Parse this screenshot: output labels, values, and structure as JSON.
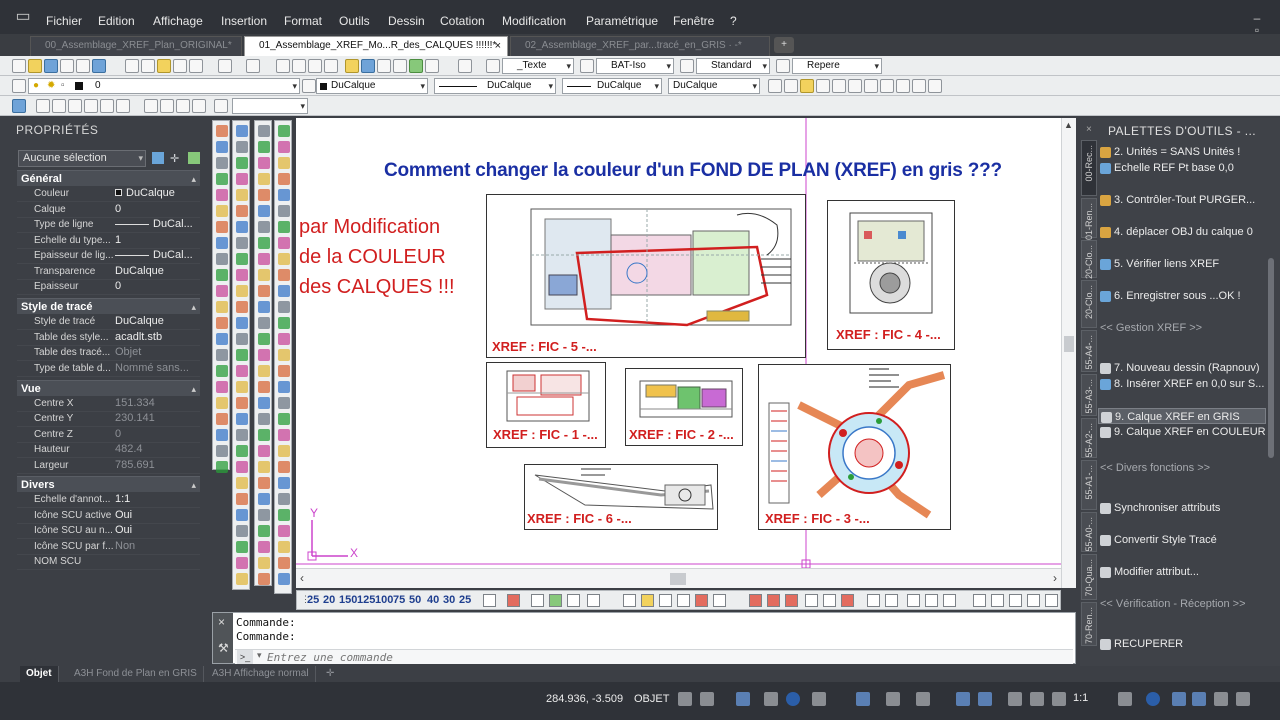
{
  "menu": [
    "Fichier",
    "Edition",
    "Affichage",
    "Insertion",
    "Format",
    "Outils",
    "Dessin",
    "Cotation",
    "Modification",
    "Paramétrique",
    "Fenêtre",
    "?"
  ],
  "doc_tabs": [
    {
      "label": "00_Assemblage_XREF_Plan_ORIGINAL*",
      "active": false
    },
    {
      "label": "01_Assemblage_XREF_Mo...R_des_CALQUES !!!!!!*",
      "active": true
    },
    {
      "label": "02_Assemblage_XREF_par...tracé_en_GRIS  · -*",
      "active": false
    }
  ],
  "toolbar": {
    "text_style": "_Texte",
    "dim_style": "BAT-Iso",
    "table_style": "Standard",
    "mleader_style": "Repere",
    "layer": "0",
    "color": "DuCalque",
    "linetype": "DuCalque",
    "lineweight": "DuCalque",
    "plotstyle": "DuCalque"
  },
  "properties": {
    "title": "PROPRIÉTÉS",
    "selection": "Aucune sélection",
    "sections": [
      {
        "title": "Général",
        "rows": [
          {
            "k": "Couleur",
            "v": "DuCalque"
          },
          {
            "k": "Calque",
            "v": "0"
          },
          {
            "k": "Type de ligne",
            "v": "DuCal..."
          },
          {
            "k": "Echelle du type...",
            "v": "1"
          },
          {
            "k": "Epaisseur de lig...",
            "v": "DuCal..."
          },
          {
            "k": "Transparence",
            "v": "DuCalque"
          },
          {
            "k": "Epaisseur",
            "v": "0"
          }
        ]
      },
      {
        "title": "Style de tracé",
        "rows": [
          {
            "k": "Style de tracé",
            "v": "DuCalque"
          },
          {
            "k": "Table des style...",
            "v": "acadlt.stb"
          },
          {
            "k": "Table des tracé...",
            "v": "Objet"
          },
          {
            "k": "Type de table d...",
            "v": "Nommé  sans..."
          }
        ]
      },
      {
        "title": "Vue",
        "rows": [
          {
            "k": "Centre X",
            "v": "151.334"
          },
          {
            "k": "Centre Y",
            "v": "230.141"
          },
          {
            "k": "Centre Z",
            "v": "0"
          },
          {
            "k": "Hauteur",
            "v": "482.4"
          },
          {
            "k": "Largeur",
            "v": "785.691"
          }
        ]
      },
      {
        "title": "Divers",
        "rows": [
          {
            "k": "Echelle d'annot...",
            "v": "1:1"
          },
          {
            "k": "Icône SCU active",
            "v": "Oui"
          },
          {
            "k": "Icône SCU au n...",
            "v": "Oui"
          },
          {
            "k": "Icône SCU par f...",
            "v": "Non"
          },
          {
            "k": "NOM SCU",
            "v": ""
          }
        ]
      }
    ]
  },
  "canvas": {
    "title": "Comment changer la couleur d'un FOND DE PLAN (XREF) en gris ???",
    "note_lines": [
      "par Modification",
      "de la COULEUR",
      "des CALQUES !!!"
    ],
    "xrefs": [
      {
        "label": "XREF : FIC - 5 -..."
      },
      {
        "label": "XREF : FIC - 4 -..."
      },
      {
        "label": "XREF : FIC - 1 -..."
      },
      {
        "label": "XREF : FIC - 2 -..."
      },
      {
        "label": "XREF : FIC - 3 -..."
      },
      {
        "label": "XREF : FIC - 6 -..."
      }
    ],
    "ucs_y": "Y",
    "ucs_x": "X"
  },
  "scale_list": [
    "25",
    "20",
    "150",
    "125",
    "100",
    "75",
    "50",
    "40",
    "30",
    "25"
  ],
  "command": {
    "history": [
      "Commande:",
      "Commande:"
    ],
    "placeholder": "Entrez une commande"
  },
  "palette": {
    "title": "PALETTES D'OUTILS - ...",
    "vtabs": [
      "00-Rec...",
      "01-Ren...",
      "20-Clo...",
      "20-Clo...",
      "55-A4-...",
      "55-A3-...",
      "55-A2-...",
      "55-A1-...",
      "55-A0-...",
      "70-Qua...",
      "70-Ren..."
    ],
    "items": [
      {
        "label": "2. Unités = SANS Unités !",
        "type": "item"
      },
      {
        "label": "Echelle REF Pt base 0,0",
        "type": "item"
      },
      {
        "label": "3. Contrôler-Tout PURGER...",
        "type": "item"
      },
      {
        "label": "4. déplacer OBJ du calque 0",
        "type": "item"
      },
      {
        "label": "5. Vérifier liens XREF",
        "type": "item"
      },
      {
        "label": "6. Enregistrer sous ...OK !",
        "type": "item"
      },
      {
        "label": "<< Gestion XREF >>",
        "type": "sep"
      },
      {
        "label": "7. Nouveau dessin (Rapnouv)",
        "type": "item"
      },
      {
        "label": "8. Insérer XREF en 0,0 sur S...",
        "type": "item"
      },
      {
        "label": "9. Calque XREF en GRIS",
        "type": "item",
        "selected": true
      },
      {
        "label": "9. Calque XREF en COULEUR",
        "type": "item"
      },
      {
        "label": "<< Divers fonctions >>",
        "type": "sep"
      },
      {
        "label": "Synchroniser attributs",
        "type": "item"
      },
      {
        "label": "Convertir Style Tracé",
        "type": "item"
      },
      {
        "label": "Modifier attribut...",
        "type": "item"
      },
      {
        "label": "<< Vérification - Réception >>",
        "type": "sep"
      },
      {
        "label": "RECUPERER",
        "type": "item"
      }
    ]
  },
  "layout_tabs": [
    {
      "label": "Objet",
      "active": true
    },
    {
      "label": "A3H Fond de Plan en GRIS",
      "active": false
    },
    {
      "label": "A3H Affichage normal",
      "active": false
    }
  ],
  "status": {
    "coords": "284.936, -3.509",
    "space": "OBJET",
    "scale": "1:1"
  },
  "colors": {
    "title_blue": "#1a2fa3",
    "note_red": "#d11f1f",
    "crosshair": "#cc44cc"
  }
}
